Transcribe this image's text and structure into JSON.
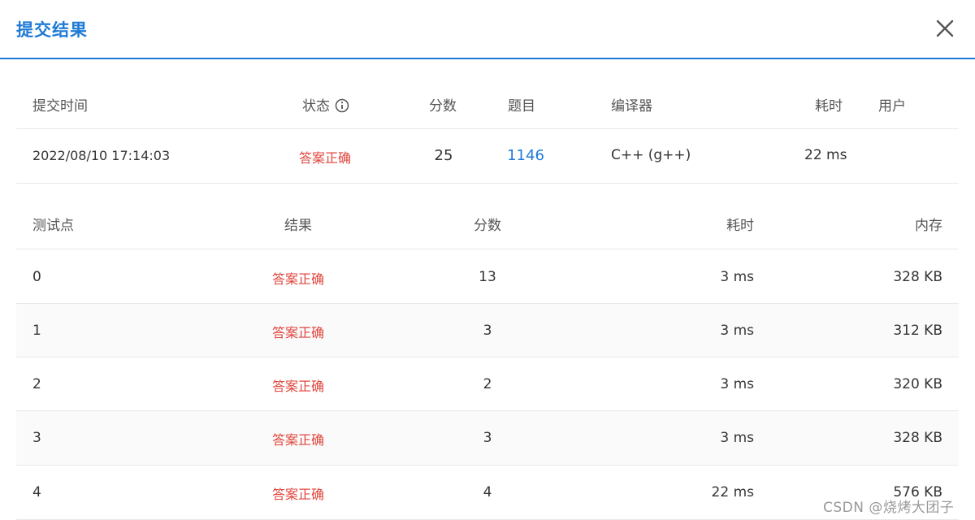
{
  "dialog": {
    "title": "提交结果"
  },
  "summary": {
    "headers": {
      "time": "提交时间",
      "status": "状态",
      "score": "分数",
      "problem": "题目",
      "compiler": "编译器",
      "elapsed": "耗时",
      "user": "用户"
    },
    "row": {
      "time": "2022/08/10 17:14:03",
      "status": "答案正确",
      "score": "25",
      "problem": "1146",
      "compiler": "C++ (g++)",
      "elapsed": "22 ms",
      "user": ""
    }
  },
  "tests": {
    "headers": {
      "case": "测试点",
      "result": "结果",
      "score": "分数",
      "elapsed": "耗时",
      "memory": "内存"
    },
    "rows": [
      {
        "case": "0",
        "result": "答案正确",
        "score": "13",
        "elapsed": "3 ms",
        "memory": "328 KB"
      },
      {
        "case": "1",
        "result": "答案正确",
        "score": "3",
        "elapsed": "3 ms",
        "memory": "312 KB"
      },
      {
        "case": "2",
        "result": "答案正确",
        "score": "2",
        "elapsed": "3 ms",
        "memory": "320 KB"
      },
      {
        "case": "3",
        "result": "答案正确",
        "score": "3",
        "elapsed": "3 ms",
        "memory": "328 KB"
      },
      {
        "case": "4",
        "result": "答案正确",
        "score": "4",
        "elapsed": "22 ms",
        "memory": "576 KB"
      }
    ]
  },
  "watermark": "CSDN @烧烤大团子",
  "colors": {
    "accent": "#1f7ad6",
    "success_text": "#e0453c"
  },
  "icons": {
    "close": "close-icon",
    "info": "info-icon"
  }
}
